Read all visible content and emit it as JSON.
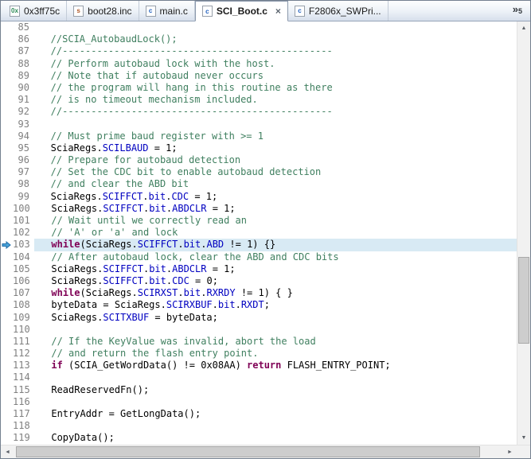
{
  "colors": {
    "comment": "#3f7f5f",
    "keyword": "#7f0055",
    "field": "#0000c0",
    "plain": "#000000",
    "line_highlight": "#d8eaf4",
    "gutter_text": "#808080",
    "ip_arrow_fill": "#4aa3d8",
    "ip_arrow_stroke": "#1f6ca8"
  },
  "tab_bar": {
    "tabs": [
      {
        "label": "0x3ff75c",
        "icon": "disassembly-file-icon",
        "icon_letter": "0x",
        "icon_color": "#2e8b57",
        "active": false
      },
      {
        "label": "boot28.inc",
        "icon": "include-file-icon",
        "icon_letter": "s",
        "icon_color": "#b05a2a",
        "active": false
      },
      {
        "label": "main.c",
        "icon": "c-source-file-icon",
        "icon_letter": "c",
        "icon_color": "#1f5fbf",
        "active": false
      },
      {
        "label": "SCI_Boot.c",
        "icon": "c-source-file-icon",
        "icon_letter": "c",
        "icon_color": "#1f5fbf",
        "active": true,
        "close_label": "×"
      },
      {
        "label": "F2806x_SWPri...",
        "icon": "c-source-file-icon",
        "icon_letter": "c",
        "icon_color": "#1f5fbf",
        "active": false
      }
    ],
    "overflow": {
      "chevron": "»",
      "count": "5"
    }
  },
  "icons": {
    "up": "▲",
    "down": "▼",
    "left": "◄",
    "right": "►"
  },
  "editor": {
    "current_line": 103,
    "lines": [
      {
        "n": 85,
        "s": []
      },
      {
        "n": 86,
        "s": [
          [
            "   //SCIA_AutobaudLock();",
            "c"
          ]
        ]
      },
      {
        "n": 87,
        "s": [
          [
            "   //-----------------------------------------------",
            "c"
          ]
        ]
      },
      {
        "n": 88,
        "s": [
          [
            "   // Perform autobaud lock with the host.",
            "c"
          ]
        ]
      },
      {
        "n": 89,
        "s": [
          [
            "   // Note that if autobaud never occurs",
            "c"
          ]
        ]
      },
      {
        "n": 90,
        "s": [
          [
            "   // the program will hang in this routine as there",
            "c"
          ]
        ]
      },
      {
        "n": 91,
        "s": [
          [
            "   // is no timeout mechanism included.",
            "c"
          ]
        ]
      },
      {
        "n": 92,
        "s": [
          [
            "   //-----------------------------------------------",
            "c"
          ]
        ]
      },
      {
        "n": 93,
        "s": []
      },
      {
        "n": 94,
        "s": [
          [
            "   // Must prime baud register with >= 1",
            "c"
          ]
        ]
      },
      {
        "n": 95,
        "s": [
          [
            "   SciaRegs.",
            "p"
          ],
          [
            "SCILBAUD",
            "f"
          ],
          [
            " = 1;",
            "p"
          ]
        ]
      },
      {
        "n": 96,
        "s": [
          [
            "   // Prepare for autobaud detection",
            "c"
          ]
        ]
      },
      {
        "n": 97,
        "s": [
          [
            "   // Set the CDC bit to enable autobaud detection",
            "c"
          ]
        ]
      },
      {
        "n": 98,
        "s": [
          [
            "   // and clear the ABD bit",
            "c"
          ]
        ]
      },
      {
        "n": 99,
        "s": [
          [
            "   SciaRegs.",
            "p"
          ],
          [
            "SCIFFCT",
            "f"
          ],
          [
            ".",
            "p"
          ],
          [
            "bit",
            "f"
          ],
          [
            ".",
            "p"
          ],
          [
            "CDC",
            "f"
          ],
          [
            " = 1;",
            "p"
          ]
        ]
      },
      {
        "n": 100,
        "s": [
          [
            "   SciaRegs.",
            "p"
          ],
          [
            "SCIFFCT",
            "f"
          ],
          [
            ".",
            "p"
          ],
          [
            "bit",
            "f"
          ],
          [
            ".",
            "p"
          ],
          [
            "ABDCLR",
            "f"
          ],
          [
            " = 1;",
            "p"
          ]
        ]
      },
      {
        "n": 101,
        "s": [
          [
            "   // Wait until we correctly read an",
            "c"
          ]
        ]
      },
      {
        "n": 102,
        "s": [
          [
            "   // 'A' or 'a' and lock",
            "c"
          ]
        ]
      },
      {
        "n": 103,
        "s": [
          [
            "   ",
            "p"
          ],
          [
            "while",
            "k"
          ],
          [
            "(SciaRegs.",
            "p"
          ],
          [
            "SCIFFCT",
            "f"
          ],
          [
            ".",
            "p"
          ],
          [
            "bit",
            "f"
          ],
          [
            ".",
            "p"
          ],
          [
            "ABD",
            "f"
          ],
          [
            " != 1) {}",
            "p"
          ]
        ]
      },
      {
        "n": 104,
        "s": [
          [
            "   // After autobaud lock, clear the ABD and CDC bits",
            "c"
          ]
        ]
      },
      {
        "n": 105,
        "s": [
          [
            "   SciaRegs.",
            "p"
          ],
          [
            "SCIFFCT",
            "f"
          ],
          [
            ".",
            "p"
          ],
          [
            "bit",
            "f"
          ],
          [
            ".",
            "p"
          ],
          [
            "ABDCLR",
            "f"
          ],
          [
            " = 1;",
            "p"
          ]
        ]
      },
      {
        "n": 106,
        "s": [
          [
            "   SciaRegs.",
            "p"
          ],
          [
            "SCIFFCT",
            "f"
          ],
          [
            ".",
            "p"
          ],
          [
            "bit",
            "f"
          ],
          [
            ".",
            "p"
          ],
          [
            "CDC",
            "f"
          ],
          [
            " = 0;",
            "p"
          ]
        ]
      },
      {
        "n": 107,
        "s": [
          [
            "   ",
            "p"
          ],
          [
            "while",
            "k"
          ],
          [
            "(SciaRegs.",
            "p"
          ],
          [
            "SCIRXST",
            "f"
          ],
          [
            ".",
            "p"
          ],
          [
            "bit",
            "f"
          ],
          [
            ".",
            "p"
          ],
          [
            "RXRDY",
            "f"
          ],
          [
            " != 1) { }",
            "p"
          ]
        ]
      },
      {
        "n": 108,
        "s": [
          [
            "   byteData = SciaRegs.",
            "p"
          ],
          [
            "SCIRXBUF",
            "f"
          ],
          [
            ".",
            "p"
          ],
          [
            "bit",
            "f"
          ],
          [
            ".",
            "p"
          ],
          [
            "RXDT",
            "f"
          ],
          [
            ";",
            "p"
          ]
        ]
      },
      {
        "n": 109,
        "s": [
          [
            "   SciaRegs.",
            "p"
          ],
          [
            "SCITXBUF",
            "f"
          ],
          [
            " = byteData;",
            "p"
          ]
        ]
      },
      {
        "n": 110,
        "s": []
      },
      {
        "n": 111,
        "s": [
          [
            "   // If the KeyValue was invalid, abort the load",
            "c"
          ]
        ]
      },
      {
        "n": 112,
        "s": [
          [
            "   // and return the flash entry point.",
            "c"
          ]
        ]
      },
      {
        "n": 113,
        "s": [
          [
            "   ",
            "p"
          ],
          [
            "if",
            "k"
          ],
          [
            " (SCIA_GetWordData() != 0x08AA) ",
            "p"
          ],
          [
            "return",
            "k"
          ],
          [
            " FLASH_ENTRY_POINT;",
            "p"
          ]
        ]
      },
      {
        "n": 114,
        "s": []
      },
      {
        "n": 115,
        "s": [
          [
            "   ReadReservedFn();",
            "p"
          ]
        ]
      },
      {
        "n": 116,
        "s": []
      },
      {
        "n": 117,
        "s": [
          [
            "   EntryAddr = GetLongData();",
            "p"
          ]
        ]
      },
      {
        "n": 118,
        "s": []
      },
      {
        "n": 119,
        "s": [
          [
            "   CopyData();",
            "p"
          ]
        ]
      }
    ]
  }
}
